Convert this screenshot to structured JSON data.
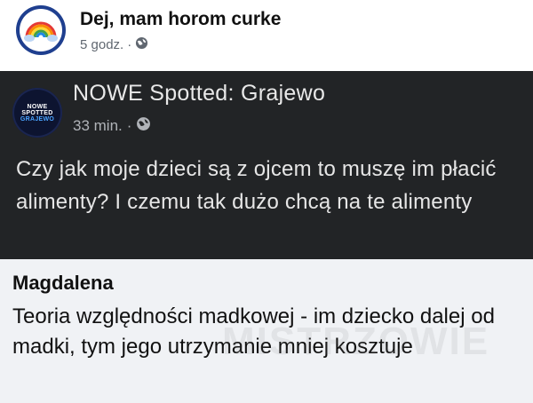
{
  "outer_post": {
    "page_name": "Dej, mam horom curke",
    "time": "5 godz.",
    "separator": "·",
    "privacy_icon": "globe-icon"
  },
  "shared_post": {
    "page_name": "NOWE Spotted: Grajewo",
    "time": "33 min.",
    "separator": "·",
    "privacy_icon": "globe-icon",
    "avatar_lines": [
      "NOWE",
      "SPOTTED",
      "GRAJEWO"
    ],
    "body": "Czy jak moje dzieci są z ojcem to muszę im płacić alimenty? I czemu tak dużo chcą na te alimenty"
  },
  "comment": {
    "author": "Magdalena",
    "text": "Teoria względności madkowej - im dziecko dalej od madki, tym jego utrzymanie mniej kosztuje"
  },
  "watermark": "MISTRZOWIE",
  "colors": {
    "dark_card_bg": "#222426",
    "comment_bg": "#f0f2f5",
    "meta_gray": "#606770"
  }
}
